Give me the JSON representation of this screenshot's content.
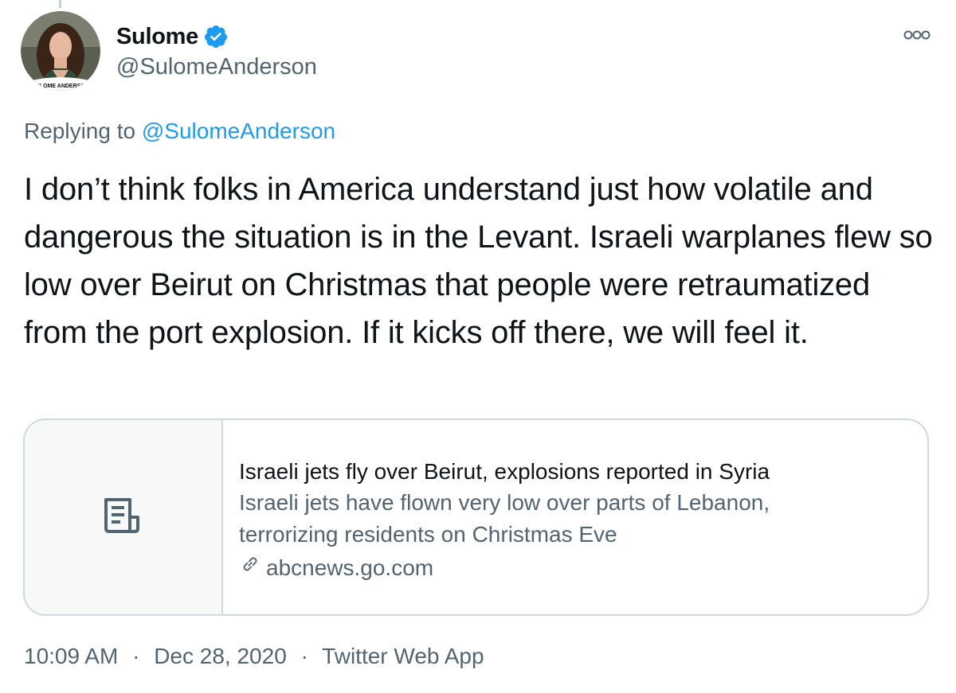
{
  "author": {
    "name": "Sulome",
    "handle": "@SulomeAnderson",
    "avatar_caption": "SULOME ANDERSON",
    "verified": true
  },
  "reply": {
    "prefix": "Replying to",
    "mention": "@SulomeAnderson"
  },
  "tweet": {
    "text": "I don’t think folks in America understand just how volatile and dangerous the situation is in the Levant. Israeli warplanes flew so low over Beirut on Christmas that people were retraumatized from the port explosion. If it kicks off there, we will feel it."
  },
  "link_card": {
    "title": "Israeli jets fly over Beirut, explosions reported in Syria",
    "description": "Israeli jets have flown very low over parts of Lebanon, terrorizing residents on Christmas Eve",
    "domain": "abcnews.go.com",
    "thumb_icon": "article-icon"
  },
  "meta": {
    "time": "10:09 AM",
    "date": "Dec 28, 2020",
    "source": "Twitter Web App",
    "separator": "·"
  },
  "colors": {
    "text": "#0f1419",
    "secondary": "#536471",
    "accent": "#1d9bf0",
    "border": "#cfd9de"
  },
  "icons": [
    "verified-badge-icon",
    "more-options-icon",
    "article-icon",
    "link-icon"
  ]
}
